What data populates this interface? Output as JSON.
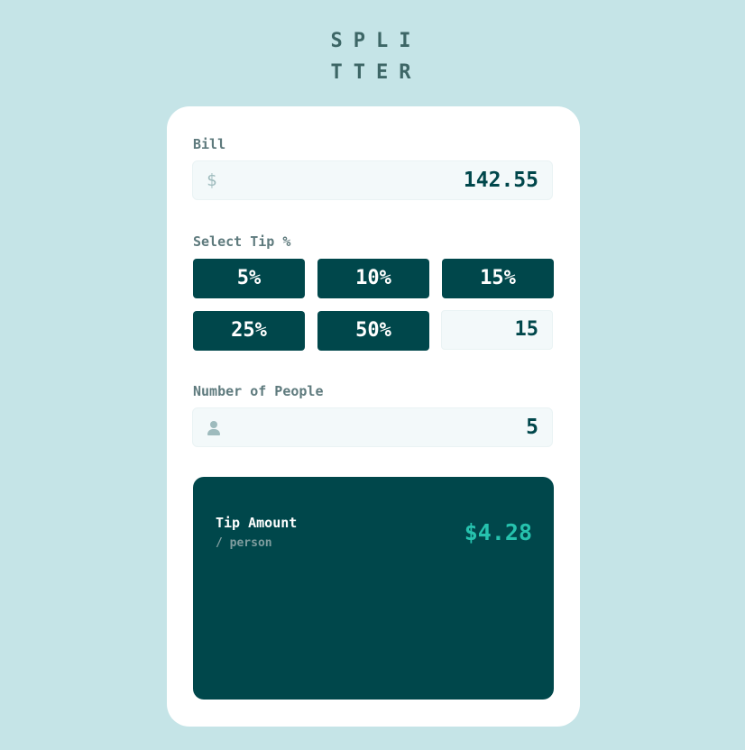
{
  "app": {
    "logo_line1": "SPLI",
    "logo_line2": "TTER"
  },
  "bill": {
    "label": "Bill",
    "currency_symbol": "$",
    "value": "142.55"
  },
  "tip": {
    "label": "Select Tip %",
    "options": [
      "5%",
      "10%",
      "15%",
      "25%",
      "50%"
    ],
    "custom_value": "15"
  },
  "people": {
    "label": "Number of People",
    "icon": "person-icon",
    "value": "5"
  },
  "result": {
    "tip_amount_label": "Tip Amount",
    "per_person_label": "/ person",
    "tip_amount_value": "$4.28"
  },
  "colors": {
    "background": "#c5e4e7",
    "dark_cyan": "#00474b",
    "accent": "#26c2ae",
    "card": "#ffffff"
  }
}
